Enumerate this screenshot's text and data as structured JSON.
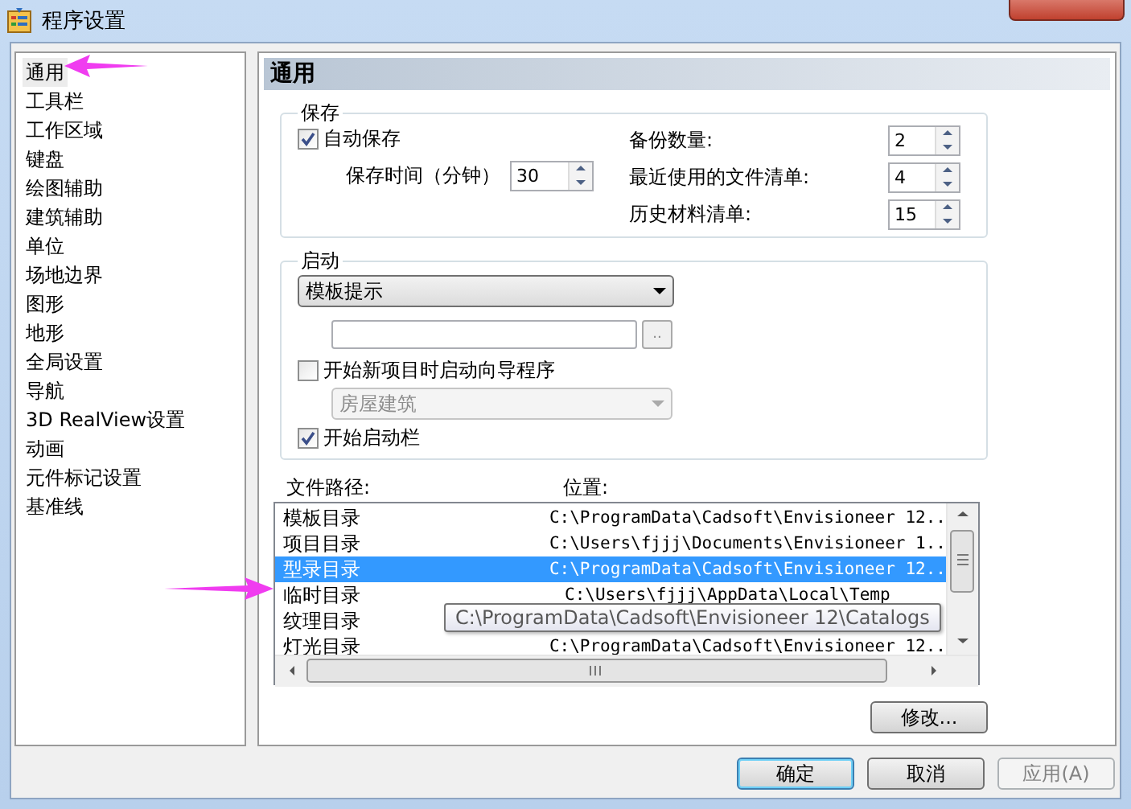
{
  "window": {
    "title": "程序设置"
  },
  "sidebar": {
    "items": [
      {
        "label": "通用",
        "selected": true
      },
      {
        "label": "工具栏",
        "selected": false
      },
      {
        "label": "工作区域",
        "selected": false
      },
      {
        "label": "键盘",
        "selected": false
      },
      {
        "label": "绘图辅助",
        "selected": false
      },
      {
        "label": "建筑辅助",
        "selected": false
      },
      {
        "label": "单位",
        "selected": false
      },
      {
        "label": "场地边界",
        "selected": false
      },
      {
        "label": "图形",
        "selected": false
      },
      {
        "label": "地形",
        "selected": false
      },
      {
        "label": "全局设置",
        "selected": false
      },
      {
        "label": "导航",
        "selected": false
      },
      {
        "label": "3D RealView设置",
        "selected": false
      },
      {
        "label": "动画",
        "selected": false
      },
      {
        "label": "元件标记设置",
        "selected": false
      },
      {
        "label": "基准线",
        "selected": false
      }
    ]
  },
  "panel": {
    "title": "通用"
  },
  "save_group": {
    "title": "保存",
    "autosave": {
      "label": "自动保存",
      "checked": true
    },
    "interval": {
      "label": "保存时间（分钟）",
      "value": "30"
    },
    "counts": [
      {
        "label": "备份数量:",
        "value": "2"
      },
      {
        "label": "最近使用的文件清单:",
        "value": "4"
      },
      {
        "label": "历史材料清单:",
        "value": "15"
      }
    ]
  },
  "startup_group": {
    "title": "启动",
    "dropdown": {
      "value": "模板提示"
    },
    "browse_button": "..",
    "wizard": {
      "label": "开始新项目时启动向导程序",
      "checked": false
    },
    "project_type": {
      "value": "房屋建筑",
      "disabled": true
    },
    "startbar": {
      "label": "开始启动栏",
      "checked": true
    }
  },
  "file_paths": {
    "columns": [
      "文件路径:",
      "位置:"
    ],
    "rows": [
      {
        "name": "模板目录",
        "path": "C:\\ProgramData\\Cadsoft\\Envisioneer 12..",
        "selected": false
      },
      {
        "name": "项目目录",
        "path": "C:\\Users\\fjjj\\Documents\\Envisioneer 1..",
        "selected": false
      },
      {
        "name": "型录目录",
        "path": "C:\\ProgramData\\Cadsoft\\Envisioneer 12..",
        "selected": true
      },
      {
        "name": "临时目录",
        "path": "C:\\Users\\fjjj\\AppData\\Local\\Temp",
        "selected": false
      },
      {
        "name": "纹理目录",
        "selected": false
      },
      {
        "name": "灯光目录",
        "path": "C:\\ProgramData\\Cadsoft\\Envisioneer 12..",
        "selected": false
      }
    ],
    "tooltip": "C:\\ProgramData\\Cadsoft\\Envisioneer 12\\Catalogs"
  },
  "modify_button": "修改...",
  "buttons": [
    {
      "label": "确定",
      "kind": "default",
      "disabled": false
    },
    {
      "label": "取消",
      "kind": "normal",
      "disabled": false
    },
    {
      "label": "应用(A)",
      "kind": "normal",
      "disabled": true
    }
  ]
}
